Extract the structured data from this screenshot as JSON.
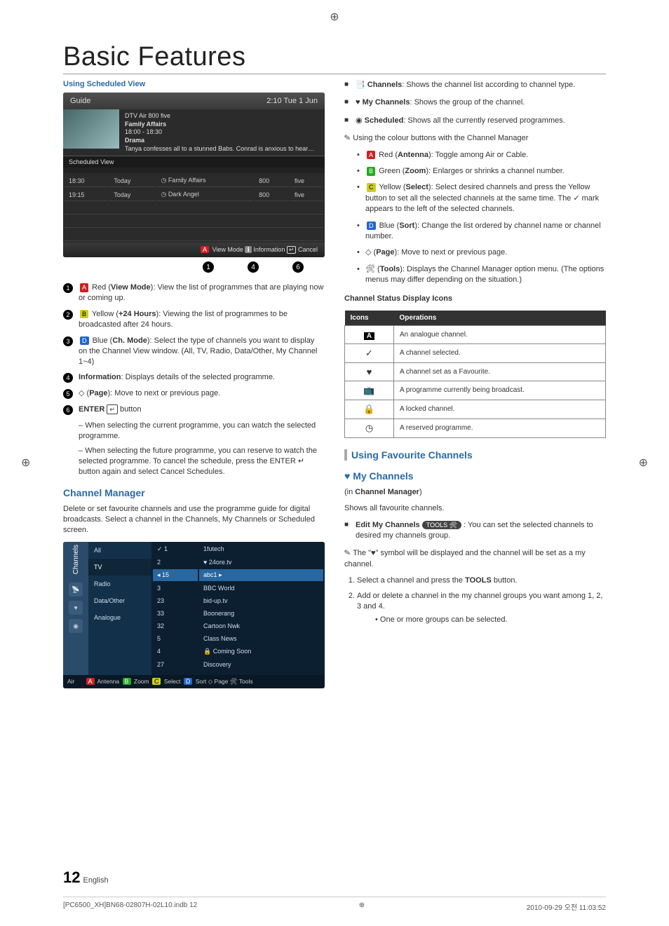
{
  "title": "Basic Features",
  "left": {
    "sec1_label": "Using Scheduled View",
    "guide": {
      "title": "Guide",
      "clock": "2:10 Tue 1 Jun",
      "channel": "DTV Air 800 five",
      "programme": "Family Affairs",
      "time": "18:00 - 18:30",
      "genre": "Drama",
      "desc": "Tanya confesses all to a stunned Babs. Conrad is anxious to hear…",
      "tab": "Scheduled View",
      "rows": [
        {
          "time": "18:30",
          "day": "Today",
          "prog": "Family Affairs",
          "ch": "800",
          "chname": "five",
          "rec": true
        },
        {
          "time": "19:15",
          "day": "Today",
          "prog": "Dark Angel",
          "ch": "800",
          "chname": "five",
          "rec": true
        }
      ],
      "footer_view": "View Mode",
      "footer_info": "Information",
      "footer_cancel": "Cancel"
    },
    "callouts": [
      "1",
      "4",
      "6"
    ],
    "numbered": [
      {
        "n": "1",
        "pre": "Red",
        "label": "View Mode",
        "text": ": View the list of programmes that are playing now or coming up.",
        "color": "red"
      },
      {
        "n": "2",
        "pre": "Yellow",
        "label": "+24 Hours",
        "text": ": Viewing the list of programmes to be broadcasted after 24 hours.",
        "color": "yel"
      },
      {
        "n": "3",
        "pre": "Blue",
        "label": "Ch. Mode",
        "text": ": Select the type of channels you want to display on the Channel View window. (All, TV, Radio, Data/Other, My Channel 1~4)",
        "color": "blu"
      },
      {
        "n": "4",
        "pre": "",
        "label": "Information",
        "text": ": Displays details of the selected programme."
      },
      {
        "n": "5",
        "pre": "",
        "label": "Page",
        "text": ": Move to next or previous page.",
        "icon": "◇"
      },
      {
        "n": "6",
        "pre": "",
        "label": "ENTER",
        "text": " button",
        "icon": "↵"
      }
    ],
    "sub6": [
      "When selecting the current programme, you can watch the selected programme.",
      "When selecting the future programme, you can reserve to watch the selected programme. To cancel the schedule, press the ENTER ↵ button again and select Cancel Schedules."
    ],
    "chmgr_title": "Channel Manager",
    "chmgr_desc": "Delete or set favourite channels and use the programme guide for digital broadcasts. Select a channel in the Channels, My Channels or Scheduled screen.",
    "chmgr": {
      "side_label": "Channels",
      "cats": [
        "All",
        "TV",
        "Radio",
        "Data/Other",
        "Analogue"
      ],
      "rows": [
        {
          "n": "1",
          "name": "1futech",
          "check": true
        },
        {
          "n": "2",
          "name": "24ore.tv",
          "heart": true
        },
        {
          "n": "15",
          "name": "abc1",
          "hi": true
        },
        {
          "n": "3",
          "name": "BBC World"
        },
        {
          "n": "23",
          "name": "bid-up.tv"
        },
        {
          "n": "33",
          "name": "Boonerang"
        },
        {
          "n": "32",
          "name": "Cartoon Nwk"
        },
        {
          "n": "5",
          "name": "Class News"
        },
        {
          "n": "4",
          "name": "Coming Soon",
          "lock": true
        },
        {
          "n": "27",
          "name": "Discovery"
        }
      ],
      "footer_left": "Air",
      "footer_btns": "A Antenna  B Zoom  C Select  D Sort  ◇ Page  🛠 Tools"
    }
  },
  "right": {
    "toplist": [
      {
        "icon": "📑",
        "bold": "Channels",
        "text": ": Shows the channel list according to channel type."
      },
      {
        "icon": "♥",
        "bold": "My Channels",
        "text": ": Shows the group of the channel."
      },
      {
        "icon": "◉",
        "bold": "Scheduled",
        "text": ": Shows all the currently reserved programmes."
      }
    ],
    "note_title": "Using the colour buttons with the Channel Manager",
    "colour_notes": [
      {
        "key": "A",
        "color": "red",
        "pre": "Red",
        "label": "Antenna",
        "text": ": Toggle among Air or Cable."
      },
      {
        "key": "B",
        "color": "grn",
        "pre": "Green",
        "label": "Zoom",
        "text": ": Enlarges or shrinks a channel number."
      },
      {
        "key": "C",
        "color": "yel",
        "pre": "Yellow",
        "label": "Select",
        "text": ": Select desired channels and press the Yellow button to set all the selected channels at the same time. The ✓ mark appears to the left of the selected channels."
      },
      {
        "key": "D",
        "color": "blu",
        "pre": "Blue",
        "label": "Sort",
        "text": ": Change the list ordered by channel name or channel number."
      },
      {
        "key": "◇",
        "plain": true,
        "label": "Page",
        "text": ": Move to next or previous page."
      },
      {
        "key": "🛠",
        "plain": true,
        "label": "Tools",
        "text": ": Displays the Channel Manager option menu. (The options menus may differ depending on the situation.)"
      }
    ],
    "status_title": "Channel Status Display Icons",
    "status_th1": "Icons",
    "status_th2": "Operations",
    "status_rows": [
      {
        "ico": "A",
        "txt": "An analogue channel.",
        "chip": true
      },
      {
        "ico": "✓",
        "txt": "A channel selected."
      },
      {
        "ico": "♥",
        "txt": "A channel set as a Favourite."
      },
      {
        "ico": "📺",
        "txt": "A programme currently being broadcast."
      },
      {
        "ico": "🔒",
        "txt": "A locked channel."
      },
      {
        "ico": "◷",
        "txt": "A reserved programme."
      }
    ],
    "fav_head": "Using Favourite Channels",
    "mych_head": "My Channels",
    "mych_sub1": "(in Channel Manager)",
    "mych_sub2": "Shows all favourite channels.",
    "edit_label": "Edit My Channels",
    "tools_label": "TOOLS 🛠",
    "edit_text": ": You can set the selected channels to desired my channels group.",
    "note2": "The \"♥\" symbol will be displayed and the channel will be set as a my channel.",
    "steps": [
      "Select a channel and press the TOOLS button.",
      "Add or delete a channel in the my channel groups you want among 1, 2, 3 and 4."
    ],
    "step_sub": "One or more groups can be selected."
  },
  "page_num": "12",
  "page_lang": "English",
  "footer_file": "[PC6500_XH]BN68-02807H-02L10.indb   12",
  "footer_time": "2010-09-29   오전 11:03:52"
}
